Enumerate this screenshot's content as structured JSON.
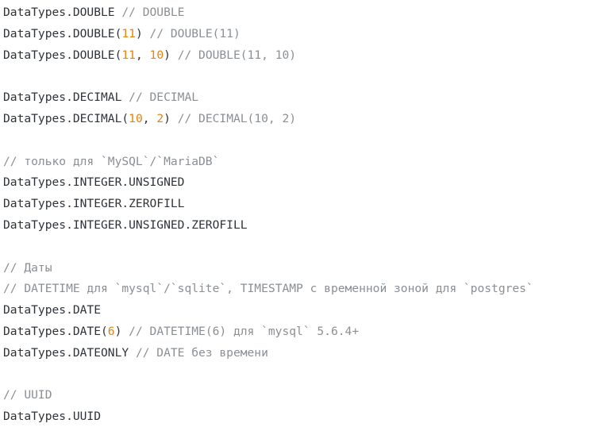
{
  "code": {
    "lines": [
      [
        {
          "t": "plain",
          "v": "DataTypes.DOUBLE "
        },
        {
          "t": "comment",
          "v": "// DOUBLE"
        }
      ],
      [
        {
          "t": "plain",
          "v": "DataTypes.DOUBLE("
        },
        {
          "t": "number",
          "v": "11"
        },
        {
          "t": "plain",
          "v": ") "
        },
        {
          "t": "comment",
          "v": "// DOUBLE(11)"
        }
      ],
      [
        {
          "t": "plain",
          "v": "DataTypes.DOUBLE("
        },
        {
          "t": "number",
          "v": "11"
        },
        {
          "t": "plain",
          "v": ", "
        },
        {
          "t": "number",
          "v": "10"
        },
        {
          "t": "plain",
          "v": ") "
        },
        {
          "t": "comment",
          "v": "// DOUBLE(11, 10)"
        }
      ],
      [],
      [
        {
          "t": "plain",
          "v": "DataTypes.DECIMAL "
        },
        {
          "t": "comment",
          "v": "// DECIMAL"
        }
      ],
      [
        {
          "t": "plain",
          "v": "DataTypes.DECIMAL("
        },
        {
          "t": "number",
          "v": "10"
        },
        {
          "t": "plain",
          "v": ", "
        },
        {
          "t": "number",
          "v": "2"
        },
        {
          "t": "plain",
          "v": ") "
        },
        {
          "t": "comment",
          "v": "// DECIMAL(10, 2)"
        }
      ],
      [],
      [
        {
          "t": "comment",
          "v": "// только для `MySQL`/`MariaDB`"
        }
      ],
      [
        {
          "t": "plain",
          "v": "DataTypes.INTEGER.UNSIGNED"
        }
      ],
      [
        {
          "t": "plain",
          "v": "DataTypes.INTEGER.ZEROFILL"
        }
      ],
      [
        {
          "t": "plain",
          "v": "DataTypes.INTEGER.UNSIGNED.ZEROFILL"
        }
      ],
      [],
      [
        {
          "t": "comment",
          "v": "// Даты"
        }
      ],
      [
        {
          "t": "comment",
          "v": "// DATETIME для `mysql`/`sqlite`, TIMESTAMP с временной зоной для `postgres`"
        }
      ],
      [
        {
          "t": "plain",
          "v": "DataTypes.DATE"
        }
      ],
      [
        {
          "t": "plain",
          "v": "DataTypes.DATE("
        },
        {
          "t": "number",
          "v": "6"
        },
        {
          "t": "plain",
          "v": ") "
        },
        {
          "t": "comment",
          "v": "// DATETIME(6) для `mysql` 5.6.4+"
        }
      ],
      [
        {
          "t": "plain",
          "v": "DataTypes.DATEONLY "
        },
        {
          "t": "comment",
          "v": "// DATE без времени"
        }
      ],
      [],
      [
        {
          "t": "comment",
          "v": "// UUID"
        }
      ],
      [
        {
          "t": "plain",
          "v": "DataTypes.UUID"
        }
      ]
    ]
  },
  "colors": {
    "plain": "#2e3338",
    "comment": "#8a8f94",
    "number": "#e8820c",
    "background": "#ffffff"
  }
}
